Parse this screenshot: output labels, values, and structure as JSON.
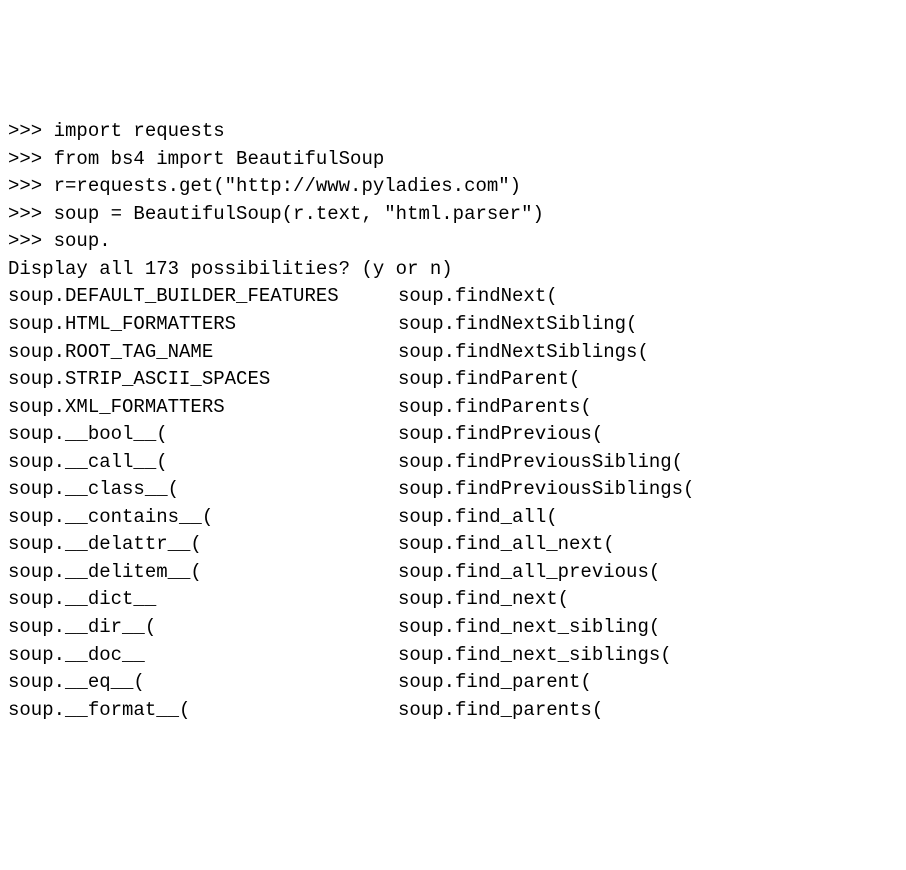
{
  "prompt": ">>>",
  "input_lines": [
    "import requests",
    "from bs4 import BeautifulSoup",
    "r=requests.get(\"http://www.pyladies.com\")",
    "soup = BeautifulSoup(r.text, \"html.parser\")",
    "soup."
  ],
  "display_prompt": "Display all 173 possibilities? (y or n)",
  "completions_col1": [
    "soup.DEFAULT_BUILDER_FEATURES",
    "soup.HTML_FORMATTERS",
    "soup.ROOT_TAG_NAME",
    "soup.STRIP_ASCII_SPACES",
    "soup.XML_FORMATTERS",
    "soup.__bool__(",
    "soup.__call__(",
    "soup.__class__(",
    "soup.__contains__(",
    "soup.__delattr__(",
    "soup.__delitem__(",
    "soup.__dict__",
    "soup.__dir__(",
    "soup.__doc__",
    "soup.__eq__(",
    "soup.__format__("
  ],
  "completions_col2": [
    "soup.findNext(",
    "soup.findNextSibling(",
    "soup.findNextSiblings(",
    "soup.findParent(",
    "soup.findParents(",
    "soup.findPrevious(",
    "soup.findPreviousSibling(",
    "soup.findPreviousSiblings(",
    "soup.find_all(",
    "soup.find_all_next(",
    "soup.find_all_previous(",
    "soup.find_next(",
    "soup.find_next_sibling(",
    "soup.find_next_siblings(",
    "soup.find_parent(",
    "soup.find_parents("
  ]
}
